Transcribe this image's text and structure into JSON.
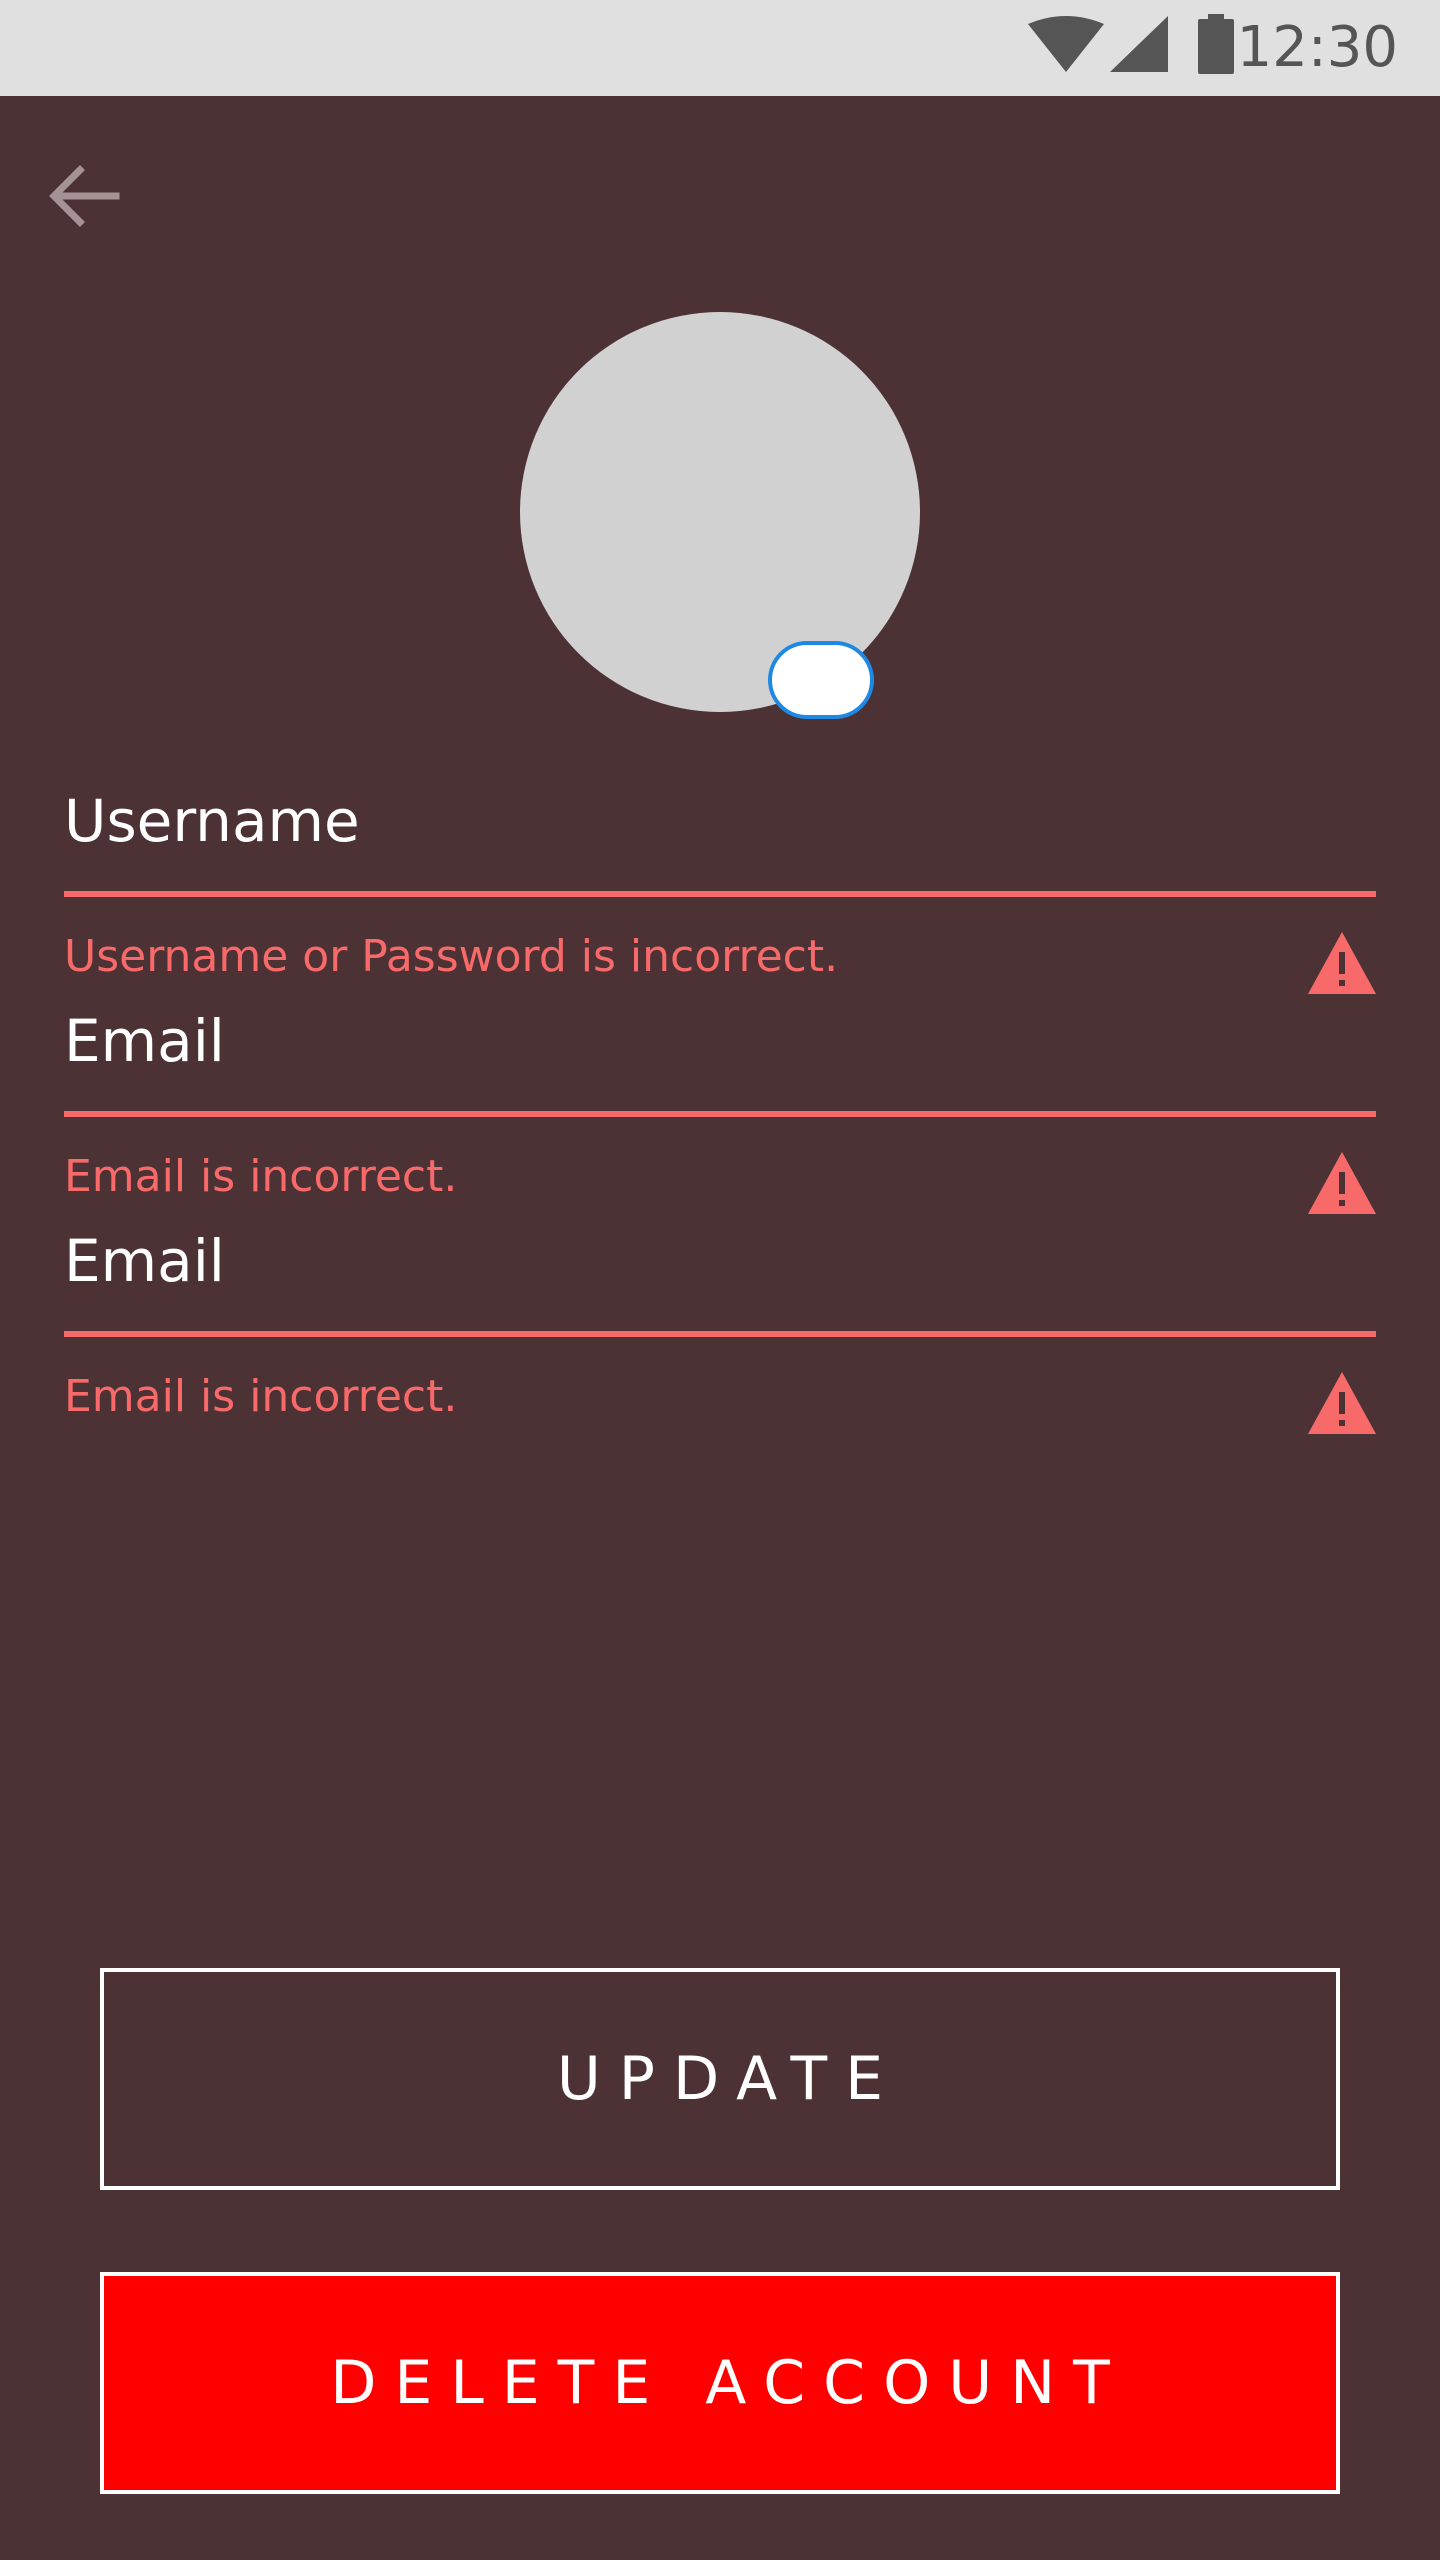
{
  "status_bar": {
    "time": "12:30",
    "wifi_icon": "wifi-icon",
    "signal_icon": "signal-icon",
    "battery_icon": "battery-icon"
  },
  "header": {
    "back_icon": "arrow-left-icon"
  },
  "profile": {
    "avatar": "avatar-placeholder",
    "edit_toggle": "avatar-edit-toggle"
  },
  "form": {
    "fields": [
      {
        "label": "Username",
        "error": "Username or Password is incorrect."
      },
      {
        "label": "Email",
        "error": "Email is incorrect."
      },
      {
        "label": "Email",
        "error": "Email is incorrect."
      }
    ]
  },
  "actions": {
    "update_label": "UPDATE",
    "delete_label": "DELETE ACCOUNT"
  },
  "colors": {
    "background": "#4d3235",
    "error": "#f86a6a",
    "danger": "#ff0000",
    "status_bar": "#e0e0e0",
    "toggle_border": "#1e88e5"
  }
}
